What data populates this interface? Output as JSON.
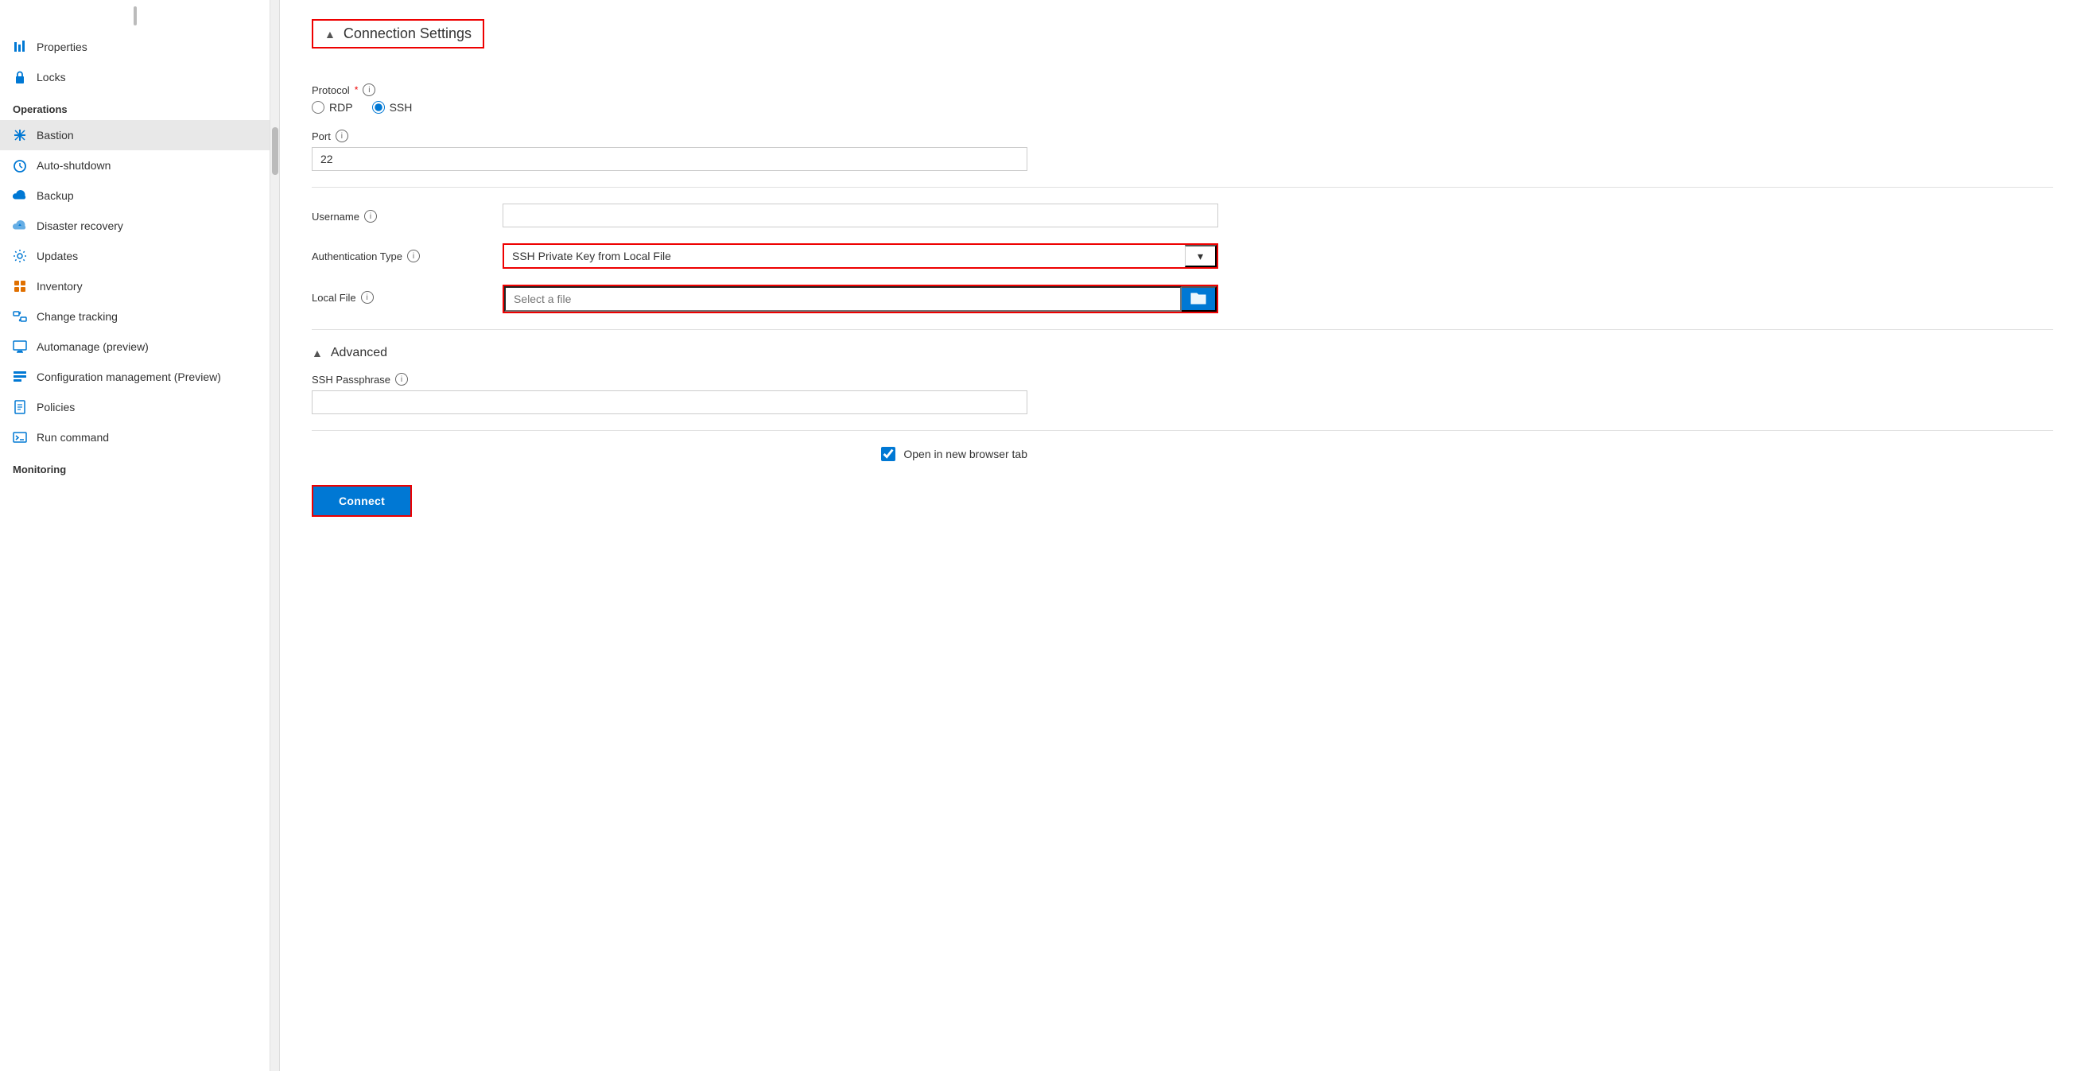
{
  "sidebar": {
    "items": [
      {
        "id": "properties",
        "label": "Properties",
        "icon": "bars",
        "color": "blue",
        "section": null
      },
      {
        "id": "locks",
        "label": "Locks",
        "icon": "lock",
        "color": "blue",
        "section": null
      },
      {
        "id": "operations-section",
        "label": "Operations",
        "type": "section"
      },
      {
        "id": "bastion",
        "label": "Bastion",
        "icon": "cross",
        "color": "blue",
        "active": true
      },
      {
        "id": "auto-shutdown",
        "label": "Auto-shutdown",
        "icon": "clock",
        "color": "blue"
      },
      {
        "id": "backup",
        "label": "Backup",
        "icon": "cloud",
        "color": "blue"
      },
      {
        "id": "disaster-recovery",
        "label": "Disaster recovery",
        "icon": "cloud-recover",
        "color": "blue"
      },
      {
        "id": "updates",
        "label": "Updates",
        "icon": "gear",
        "color": "blue"
      },
      {
        "id": "inventory",
        "label": "Inventory",
        "icon": "inventory",
        "color": "orange"
      },
      {
        "id": "change-tracking",
        "label": "Change tracking",
        "icon": "change",
        "color": "blue"
      },
      {
        "id": "automanage",
        "label": "Automanage (preview)",
        "icon": "monitor",
        "color": "blue"
      },
      {
        "id": "config-mgmt",
        "label": "Configuration management (Preview)",
        "icon": "config",
        "color": "blue"
      },
      {
        "id": "policies",
        "label": "Policies",
        "icon": "policies",
        "color": "blue"
      },
      {
        "id": "run-command",
        "label": "Run command",
        "icon": "run",
        "color": "blue"
      },
      {
        "id": "monitoring-section",
        "label": "Monitoring",
        "type": "section"
      }
    ]
  },
  "connection_settings": {
    "title": "Connection Settings",
    "chevron": "▲",
    "protocol_label": "Protocol",
    "protocol_required": "*",
    "protocol_options": [
      "RDP",
      "SSH"
    ],
    "protocol_selected": "SSH",
    "port_label": "Port",
    "port_value": "22",
    "username_label": "Username",
    "username_placeholder": "",
    "auth_type_label": "Authentication Type",
    "auth_type_value": "SSH Private Key from Local File",
    "auth_type_dropdown_icon": "▾",
    "local_file_label": "Local File",
    "local_file_placeholder": "Select a file",
    "file_btn_icon": "📁",
    "advanced_title": "Advanced",
    "advanced_chevron": "▲",
    "passphrase_label": "SSH Passphrase",
    "passphrase_value": "",
    "open_new_tab_label": "Open in new browser tab",
    "open_new_tab_checked": true,
    "connect_btn_label": "Connect"
  }
}
